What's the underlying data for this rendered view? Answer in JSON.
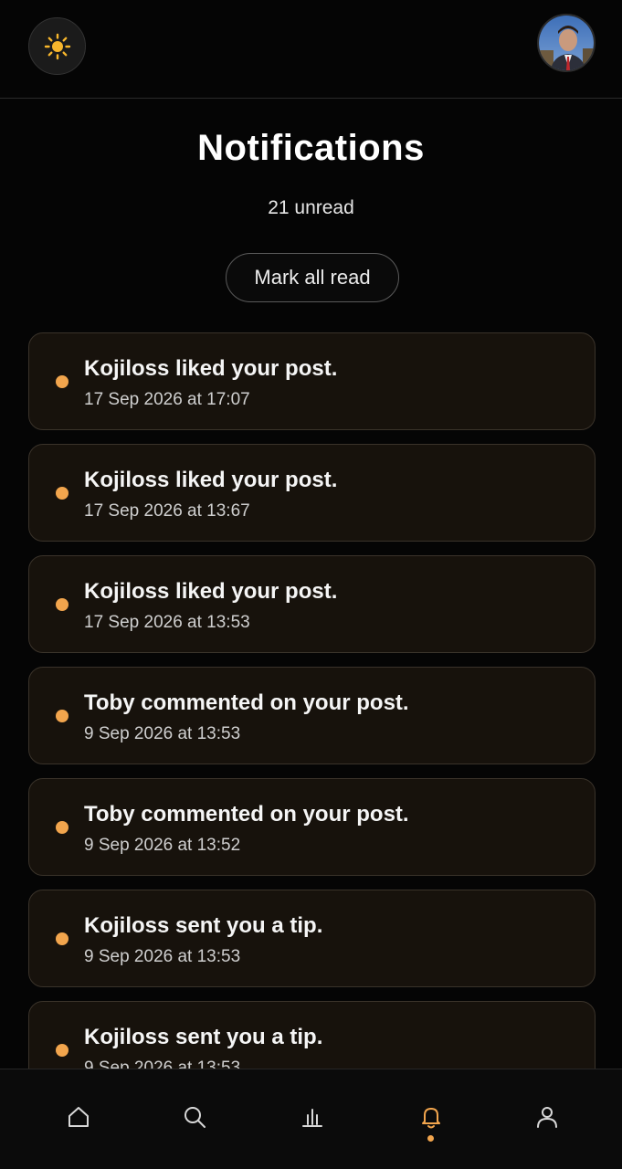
{
  "header": {
    "theme_toggle_icon": "sun-icon",
    "avatar_icon": "user-avatar"
  },
  "title": "Notifications",
  "unread": "21 unread",
  "mark_all_read_label": "Mark all read",
  "accent_color": "#f2a54d",
  "notifications": [
    {
      "title": "Kojiloss liked your post.",
      "time": "17 Sep 2026 at 17:07",
      "unread": true
    },
    {
      "title": "Kojiloss liked your post.",
      "time": "17 Sep 2026 at 13:67",
      "unread": true
    },
    {
      "title": "Kojiloss liked your post.",
      "time": "17 Sep 2026 at 13:53",
      "unread": true
    },
    {
      "title": "Toby commented on your post.",
      "time": "9 Sep 2026 at 13:53",
      "unread": true
    },
    {
      "title": "Toby commented on your post.",
      "time": "9 Sep 2026 at 13:52",
      "unread": true
    },
    {
      "title": "Kojiloss sent you a tip.",
      "time": "9 Sep 2026 at 13:53",
      "unread": true
    },
    {
      "title": "Kojiloss sent you a tip.",
      "time": "9 Sep 2026 at 13:53",
      "unread": true
    }
  ],
  "bottom_nav": [
    {
      "icon": "home-icon"
    },
    {
      "icon": "search-icon"
    },
    {
      "icon": "stats-icon"
    },
    {
      "icon": "bell-icon",
      "active": true
    },
    {
      "icon": "profile-icon"
    }
  ]
}
